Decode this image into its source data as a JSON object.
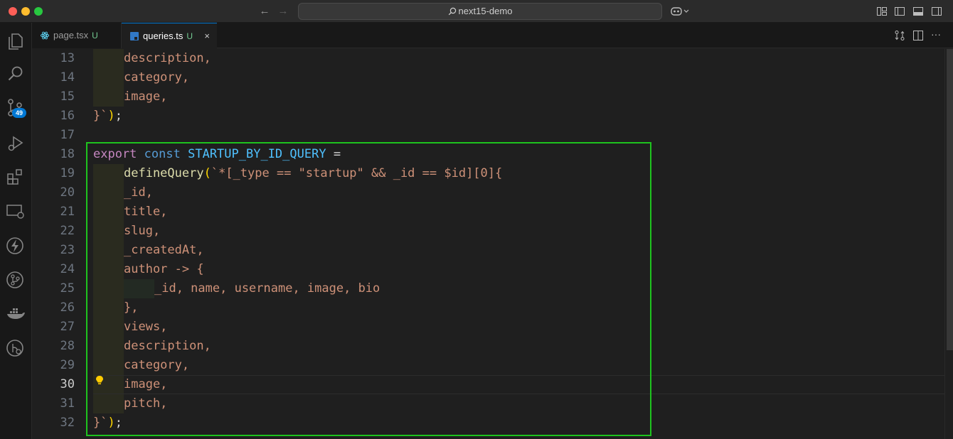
{
  "window": {
    "search_text": "next15-demo"
  },
  "tabs": [
    {
      "label": "page.tsx",
      "status": "U",
      "icon": "react-icon",
      "icon_color": "#61dafb"
    },
    {
      "label": "queries.ts",
      "status": "U",
      "icon": "typescript-icon",
      "icon_color": "#3178c6",
      "close": "×"
    }
  ],
  "activity": {
    "source_control_badge": "49",
    "items": [
      "explorer-icon",
      "search-icon",
      "source-control-icon",
      "run-debug-icon",
      "extensions-icon",
      "remote-explorer-icon",
      "lightning-icon",
      "git-graph-icon",
      "docker-icon",
      "timeline-icon"
    ]
  },
  "editor": {
    "active_line": "30",
    "line_numbers": [
      "13",
      "14",
      "15",
      "16",
      "17",
      "18",
      "19",
      "20",
      "21",
      "22",
      "23",
      "24",
      "25",
      "26",
      "27",
      "28",
      "29",
      "30",
      "31",
      "32"
    ],
    "lines": {
      "l13": "description,",
      "l14": "category,",
      "l15": "image,",
      "l16_a": "}`",
      "l16_b": ")",
      "l16_c": ";",
      "l18_a": "export",
      "l18_b": "const",
      "l18_c": "STARTUP_BY_ID_QUERY",
      "l18_d": "=",
      "l19_a": "defineQuery",
      "l19_b": "(",
      "l19_c": "`*[_type == \"startup\" && _id == $id][0]{",
      "l20": "_id,",
      "l21": "title,",
      "l22": "slug,",
      "l23": "_createdAt,",
      "l24": "author -> {",
      "l25": "_id, name, username, image, bio",
      "l26": "},",
      "l27": "views,",
      "l28": "description,",
      "l29": "category,",
      "l30": "image,",
      "l31": "pitch,",
      "l32_a": "}`",
      "l32_b": ")",
      "l32_c": ";"
    }
  },
  "colors": {
    "accent": "#0078d4",
    "highlight_box": "#1ec31e",
    "keyword": "#c586c0",
    "storage": "#569cd6",
    "constant": "#4fc1ff",
    "function": "#dcdcaa",
    "string": "#ce9178"
  }
}
